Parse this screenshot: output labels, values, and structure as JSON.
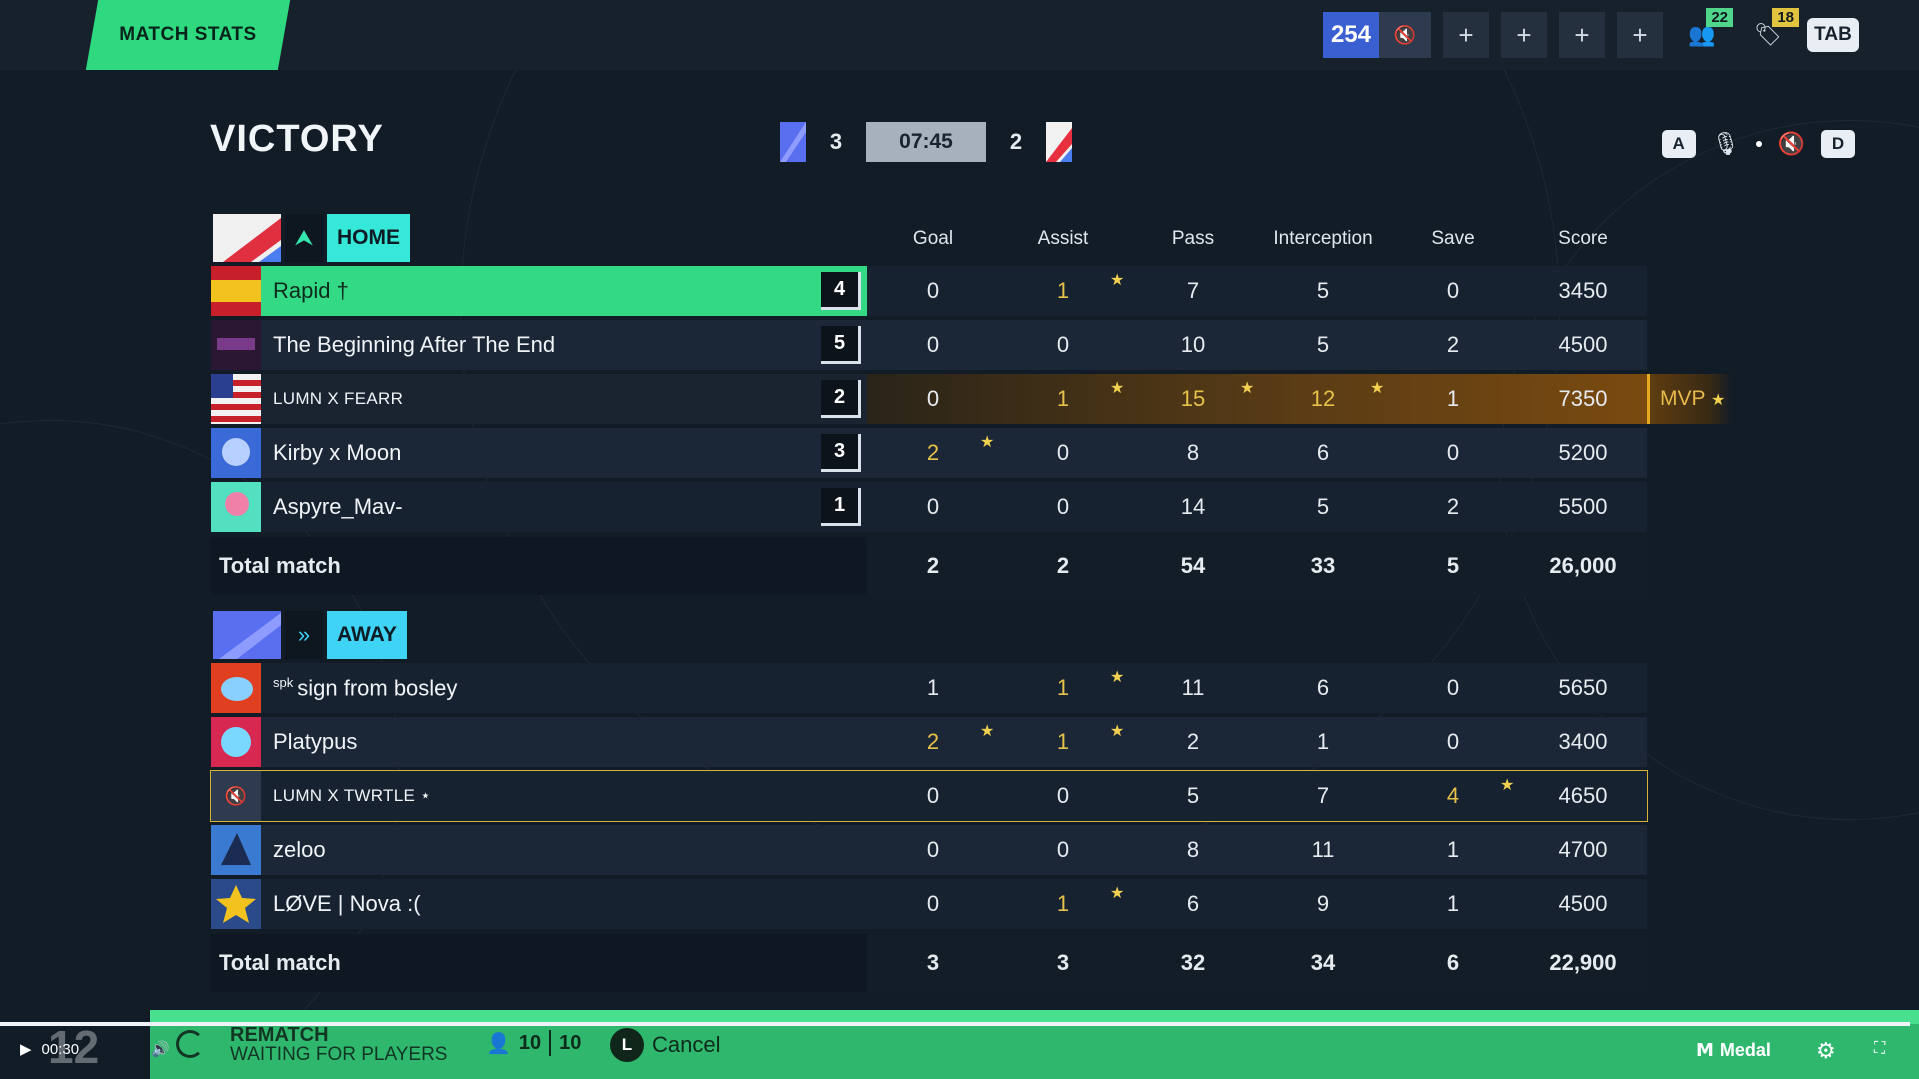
{
  "topbar": {
    "tab_label": "MATCH STATS",
    "level": "254",
    "friends_count": "22",
    "notif_count": "18",
    "tab_key": "TAB"
  },
  "header": {
    "result": "VICTORY",
    "blue_score": "3",
    "timer": "07:45",
    "red_score": "2",
    "key_a": "A",
    "key_d": "D"
  },
  "columns": [
    "Goal",
    "Assist",
    "Pass",
    "Interception",
    "Save",
    "Score"
  ],
  "home": {
    "label": "HOME",
    "players": [
      {
        "name": "Rapid †",
        "level": "4",
        "stats": [
          "0",
          "1",
          "7",
          "5",
          "0",
          "3450"
        ]
      },
      {
        "name": "The Beginning After The End",
        "level": "5",
        "stats": [
          "0",
          "0",
          "10",
          "5",
          "2",
          "4500"
        ]
      },
      {
        "name": "LUMN X FEARR",
        "level": "2",
        "stats": [
          "0",
          "1",
          "15",
          "12",
          "1",
          "7350"
        ]
      },
      {
        "name": "Kirby x Moon",
        "level": "3",
        "stats": [
          "2",
          "0",
          "8",
          "6",
          "0",
          "5200"
        ]
      },
      {
        "name": "Aspyre_Mav-",
        "level": "1",
        "stats": [
          "0",
          "0",
          "14",
          "5",
          "2",
          "5500"
        ]
      }
    ],
    "total_label": "Total match",
    "totals": [
      "2",
      "2",
      "54",
      "33",
      "5",
      "26,000"
    ],
    "mvp_label": "MVP"
  },
  "away": {
    "label": "AWAY",
    "players": [
      {
        "tag": "spk",
        "name": "sign from bosley",
        "stats": [
          "1",
          "1",
          "11",
          "6",
          "0",
          "5650"
        ]
      },
      {
        "name": "Platypus",
        "stats": [
          "2",
          "1",
          "2",
          "1",
          "0",
          "3400"
        ]
      },
      {
        "name": "LUMN X TWRTLE ⋆",
        "stats": [
          "0",
          "0",
          "5",
          "7",
          "4",
          "4650"
        ]
      },
      {
        "name": "zeloo",
        "stats": [
          "0",
          "0",
          "8",
          "11",
          "1",
          "4700"
        ]
      },
      {
        "name": "LØVE | Nova :(",
        "stats": [
          "0",
          "1",
          "6",
          "9",
          "1",
          "4500"
        ]
      }
    ],
    "total_label": "Total match",
    "totals": [
      "3",
      "3",
      "32",
      "34",
      "6",
      "22,900"
    ]
  },
  "bottom": {
    "rematch_title": "REMATCH",
    "rematch_sub": "WAITING FOR PLAYERS",
    "players_ready": "10",
    "players_total": "10",
    "cancel_key": "L",
    "cancel_label": "Cancel",
    "time": "00:30",
    "overlay_num": "12",
    "medal_label": "Medal"
  },
  "colors": {
    "accent_green": "#2fd97f",
    "home_label": "#35e8d8",
    "away_label": "#3fd3f5",
    "gold": "#e7c24a"
  }
}
